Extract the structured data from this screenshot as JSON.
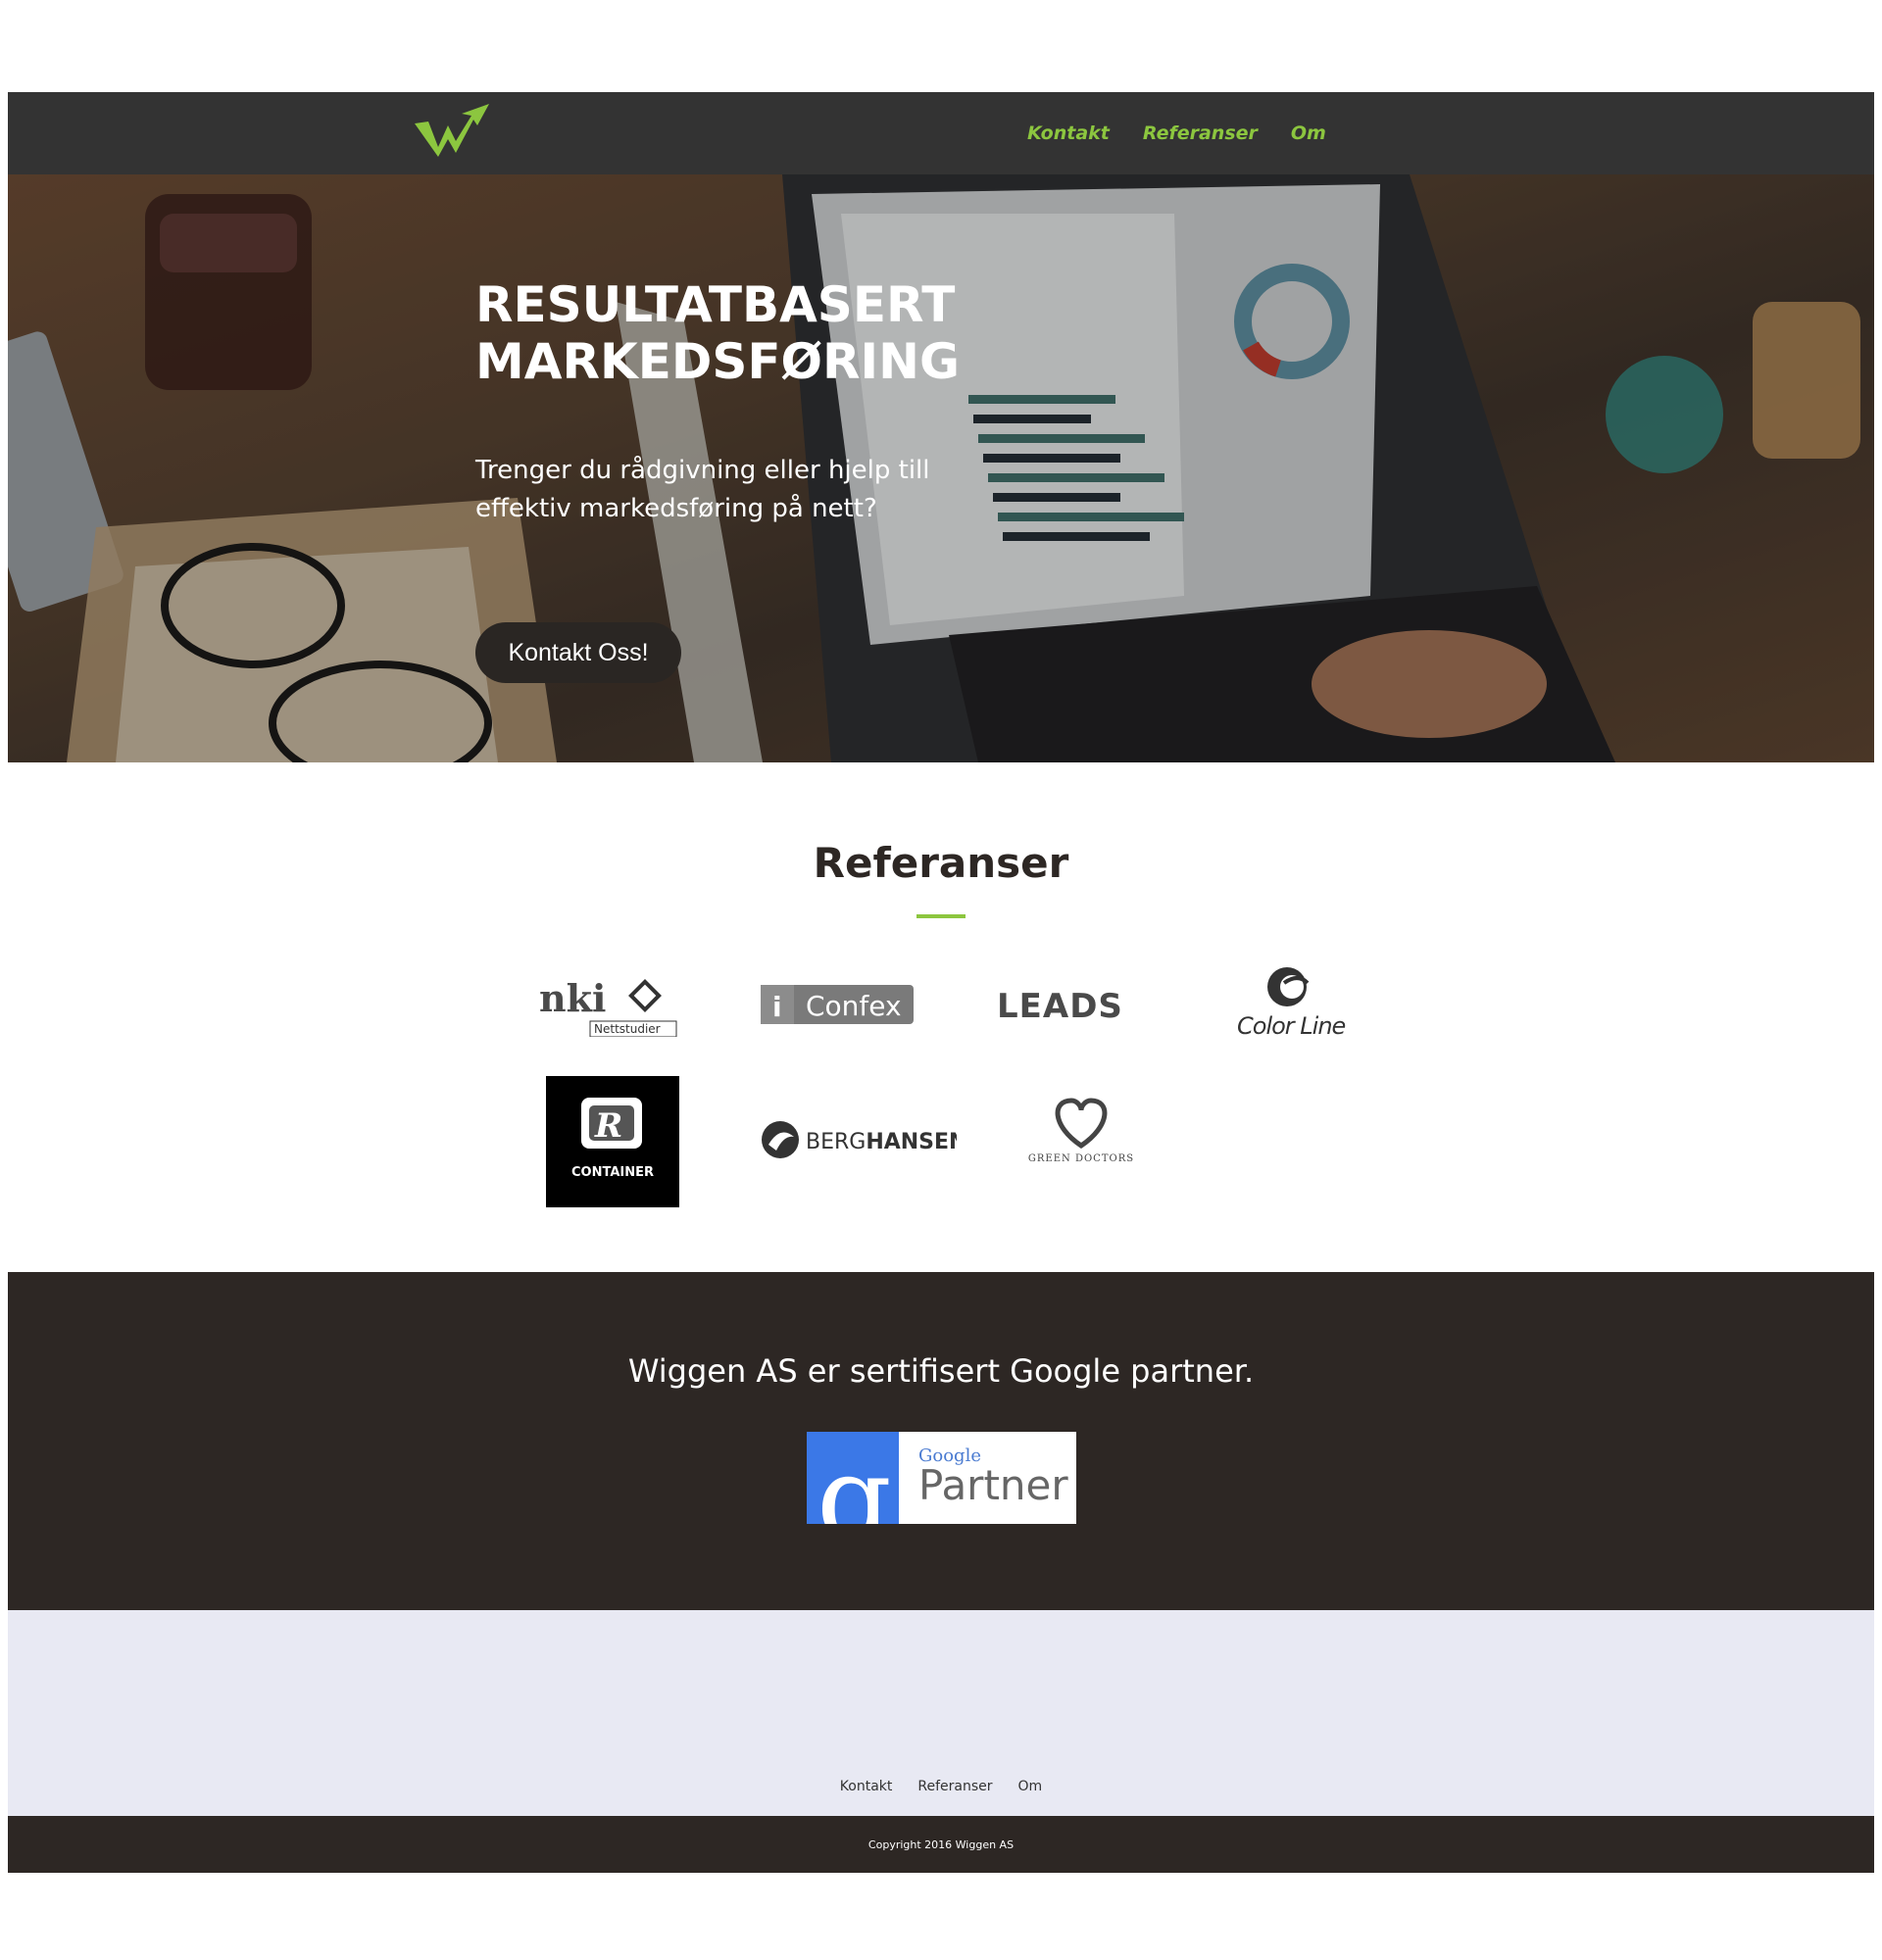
{
  "nav": {
    "links": [
      "Kontakt",
      "Referanser",
      "Om"
    ],
    "logo_icon": "wiggen-w-logo",
    "accent_color": "#8cc63f"
  },
  "hero": {
    "title_line1": "RESULTATBASERT",
    "title_line2": "MARKEDSFØRING",
    "subtitle": "Trenger du rådgivning eller hjelp till effektiv markedsføring på nett?",
    "button_label": "Kontakt Oss!"
  },
  "references": {
    "title": "Referanser",
    "logos": [
      {
        "name": "nki",
        "text": "nki",
        "subtext": "Nettstudier"
      },
      {
        "name": "confex",
        "text": "Confex"
      },
      {
        "name": "leads",
        "text": "LEADS"
      },
      {
        "name": "colorline",
        "text": "Color Line"
      },
      {
        "name": "r-container",
        "text": "CONTAINER"
      },
      {
        "name": "berghansen",
        "text": "BERG",
        "text2": "HANSEN"
      },
      {
        "name": "green-doctors",
        "text": "GREEN DOCTORS"
      }
    ]
  },
  "partner": {
    "text": "Wiggen AS er sertifisert Google partner.",
    "badge_small": "Google",
    "badge_big": "Partner"
  },
  "footer": {
    "links": [
      "Kontakt",
      "Referanser",
      "Om"
    ],
    "copyright": "Copyright 2016 Wiggen AS"
  },
  "colors": {
    "dark": "#2d2724",
    "navbar": "#333333",
    "footer_light": "#e8e9f3",
    "accent": "#8cc63f"
  }
}
